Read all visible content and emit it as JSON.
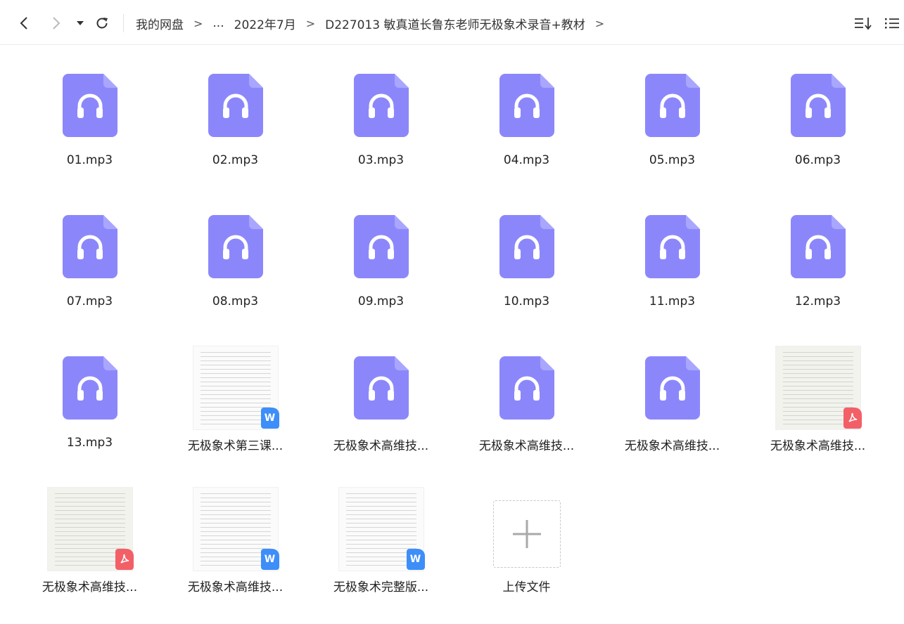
{
  "nav": {
    "back_icon": "chevron-left-icon",
    "forward_icon": "chevron-right-icon",
    "history_icon": "caret-down-icon",
    "refresh_icon": "refresh-icon",
    "breadcrumbs": [
      "我的网盘",
      "...",
      "2022年7月",
      "D227013 敏真道长鲁东老师无极象术录音+教材"
    ],
    "separator": ">",
    "sort_icon": "sort-icon",
    "view_icon": "list-view-icon"
  },
  "colors": {
    "audio": "#8b87fb",
    "word": "#3d8ef8",
    "pdf": "#f35f67"
  },
  "files": [
    {
      "name": "01.mp3",
      "type": "audio"
    },
    {
      "name": "02.mp3",
      "type": "audio"
    },
    {
      "name": "03.mp3",
      "type": "audio"
    },
    {
      "name": "04.mp3",
      "type": "audio"
    },
    {
      "name": "05.mp3",
      "type": "audio"
    },
    {
      "name": "06.mp3",
      "type": "audio"
    },
    {
      "name": "07.mp3",
      "type": "audio"
    },
    {
      "name": "08.mp3",
      "type": "audio"
    },
    {
      "name": "09.mp3",
      "type": "audio"
    },
    {
      "name": "10.mp3",
      "type": "audio"
    },
    {
      "name": "11.mp3",
      "type": "audio"
    },
    {
      "name": "12.mp3",
      "type": "audio"
    },
    {
      "name": "13.mp3",
      "type": "audio"
    },
    {
      "name": "无极象术第三课...",
      "type": "word"
    },
    {
      "name": "无极象术高维技...",
      "type": "audio"
    },
    {
      "name": "无极象术高维技...",
      "type": "audio"
    },
    {
      "name": "无极象术高维技...",
      "type": "audio"
    },
    {
      "name": "无极象术高维技...",
      "type": "pdf"
    },
    {
      "name": "无极象术高维技...",
      "type": "pdf"
    },
    {
      "name": "无极象术高维技...",
      "type": "word"
    },
    {
      "name": "无极象术完整版...",
      "type": "word"
    }
  ],
  "upload": {
    "label": "上传文件",
    "icon": "plus-icon"
  },
  "badges": {
    "word": "W"
  }
}
